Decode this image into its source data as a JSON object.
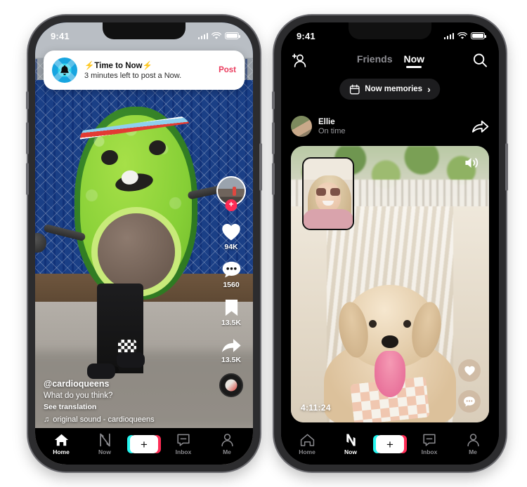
{
  "left_phone": {
    "status_bar": {
      "time": "9:41",
      "cellular_icon": "signal-bars-icon",
      "wifi_icon": "wifi-icon",
      "battery_icon": "battery-icon"
    },
    "notification": {
      "app_icon": "bell-icon",
      "title": "⚡Time to Now⚡",
      "subtitle": "3 minutes left to post a Now.",
      "action_label": "Post",
      "action_color": "#ea3b5d"
    },
    "video": {
      "description": "Person in green balloon avocado costume walking past a blue chain-link fence"
    },
    "action_rail": [
      {
        "name": "profile-avatar",
        "icon": "avatar-with-plus",
        "badge": "+",
        "count": ""
      },
      {
        "name": "like",
        "icon": "heart-icon",
        "count": "94K"
      },
      {
        "name": "comment",
        "icon": "comment-icon",
        "count": "1560"
      },
      {
        "name": "bookmark",
        "icon": "bookmark-icon",
        "count": "13.5K"
      },
      {
        "name": "share",
        "icon": "share-arrow-icon",
        "count": "13.5K"
      }
    ],
    "caption": {
      "username": "@cardioqueens",
      "text": "What do you think?",
      "translation_link": "See translation",
      "sound": "original sound - cardioqueens",
      "sound_icon": "music-note-icon"
    },
    "tabbar": {
      "items": [
        {
          "label": "Home",
          "icon": "home-icon",
          "active": true
        },
        {
          "label": "Now",
          "icon": "now-bolt-icon",
          "active": false
        },
        {
          "label": "",
          "icon": "create-plus-icon",
          "active": false
        },
        {
          "label": "Inbox",
          "icon": "inbox-icon",
          "active": false
        },
        {
          "label": "Me",
          "icon": "person-icon",
          "active": false
        }
      ],
      "create_plus": "+"
    }
  },
  "right_phone": {
    "status_bar": {
      "time": "9:41",
      "cellular_icon": "signal-bars-icon",
      "wifi_icon": "wifi-icon",
      "battery_icon": "battery-icon"
    },
    "header": {
      "add_friend_icon": "add-person-icon",
      "search_icon": "search-icon",
      "tabs": [
        {
          "label": "Friends",
          "active": false
        },
        {
          "label": "Now",
          "active": true
        }
      ]
    },
    "memories_pill": {
      "icon": "calendar-icon",
      "label": "Now memories",
      "chevron": "›"
    },
    "poster": {
      "avatar": "user-avatar",
      "name": "Ellie",
      "status": "On time",
      "share_icon": "share-arrow-icon"
    },
    "now_card": {
      "description": "Cream cockapoo dog with pink tongue lying in a hammock, white picket fence and trees behind",
      "pip_description": "Selfie of blonde woman in sunglasses in a hammock",
      "speaker_icon": "speaker-on-icon",
      "timestamp": "4:11:24",
      "actions": [
        {
          "name": "like",
          "icon": "heart-icon"
        },
        {
          "name": "comment",
          "icon": "comment-dots-icon"
        }
      ]
    },
    "tabbar": {
      "items": [
        {
          "label": "Home",
          "icon": "home-icon",
          "active": false
        },
        {
          "label": "Now",
          "icon": "now-bolt-icon",
          "active": true
        },
        {
          "label": "",
          "icon": "create-plus-icon",
          "active": false
        },
        {
          "label": "Inbox",
          "icon": "inbox-icon",
          "active": false
        },
        {
          "label": "Me",
          "icon": "person-icon",
          "active": false
        }
      ],
      "create_plus": "+"
    }
  },
  "colors": {
    "accent_pink": "#fe2c55",
    "accent_cyan": "#25f4ee",
    "post_red": "#ea3b5d",
    "inactive_gray": "#8a8a8e"
  }
}
